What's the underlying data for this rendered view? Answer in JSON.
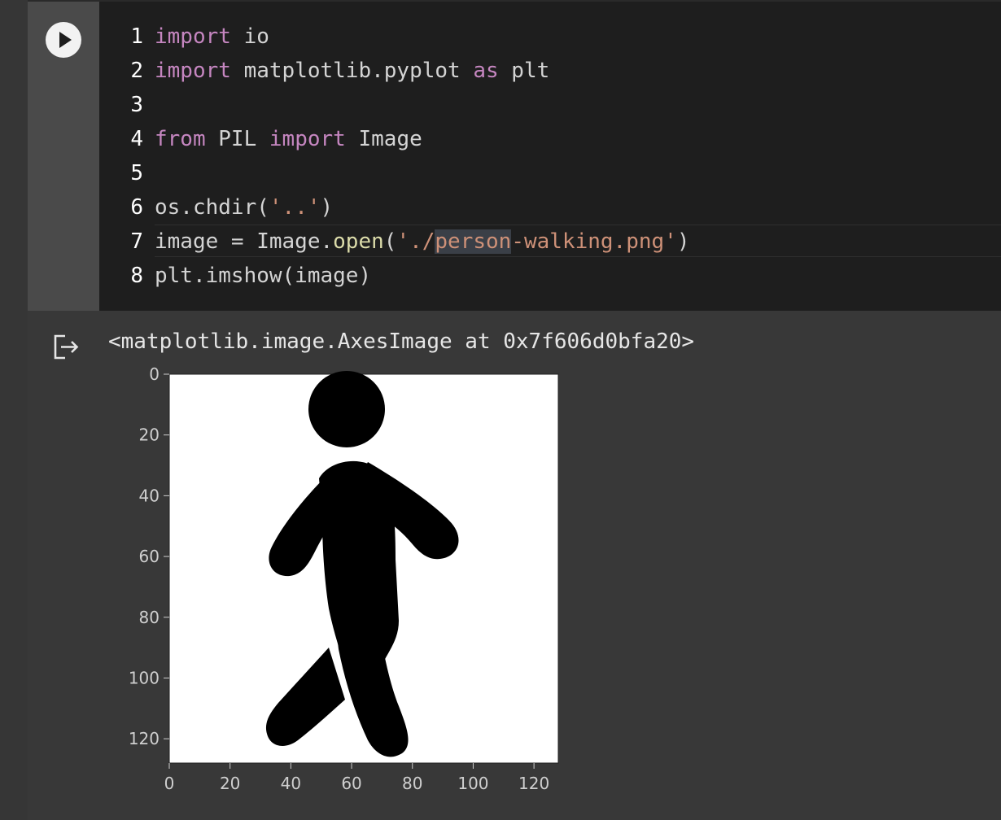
{
  "code_lines": [
    {
      "no": "1",
      "tokens": [
        {
          "t": "import",
          "c": "kw"
        },
        {
          "t": " io",
          "c": "plain"
        }
      ]
    },
    {
      "no": "2",
      "tokens": [
        {
          "t": "import",
          "c": "kw"
        },
        {
          "t": " matplotlib.pyplot ",
          "c": "plain"
        },
        {
          "t": "as",
          "c": "kw"
        },
        {
          "t": " plt",
          "c": "plain"
        }
      ]
    },
    {
      "no": "3",
      "tokens": []
    },
    {
      "no": "4",
      "tokens": [
        {
          "t": "from",
          "c": "kw"
        },
        {
          "t": " PIL ",
          "c": "plain"
        },
        {
          "t": "import",
          "c": "kw"
        },
        {
          "t": " Image",
          "c": "plain"
        }
      ]
    },
    {
      "no": "5",
      "tokens": []
    },
    {
      "no": "6",
      "tokens": [
        {
          "t": "os.chdir(",
          "c": "plain"
        },
        {
          "t": "'..'",
          "c": "str"
        },
        {
          "t": ")",
          "c": "plain"
        }
      ]
    },
    {
      "no": "7",
      "tokens": [
        {
          "t": "image = Image.",
          "c": "plain"
        },
        {
          "t": "open",
          "c": "fn"
        },
        {
          "t": "(",
          "c": "plain"
        },
        {
          "t": "'./",
          "c": "str"
        },
        {
          "t": "person",
          "c": "str hl"
        },
        {
          "t": "-walking.png'",
          "c": "str"
        },
        {
          "t": ")",
          "c": "plain"
        }
      ]
    },
    {
      "no": "8",
      "tokens": [
        {
          "t": "plt.imshow(image)",
          "c": "plain"
        }
      ]
    }
  ],
  "output": {
    "text": "<matplotlib.image.AxesImage at 0x7f606d0bfa20>"
  },
  "chart_data": {
    "type": "image",
    "xticks": [
      "0",
      "20",
      "40",
      "60",
      "80",
      "100",
      "120"
    ],
    "yticks": [
      "0",
      "20",
      "40",
      "60",
      "80",
      "100",
      "120"
    ],
    "xlim": [
      0,
      128
    ],
    "ylim": [
      128,
      0
    ],
    "image_subject": "person-walking-icon"
  },
  "colors": {
    "editor_bg": "#1e1e1e",
    "keyword": "#c586c0",
    "function": "#dcdcaa",
    "string": "#ce9178",
    "text": "#d4d4d4"
  }
}
